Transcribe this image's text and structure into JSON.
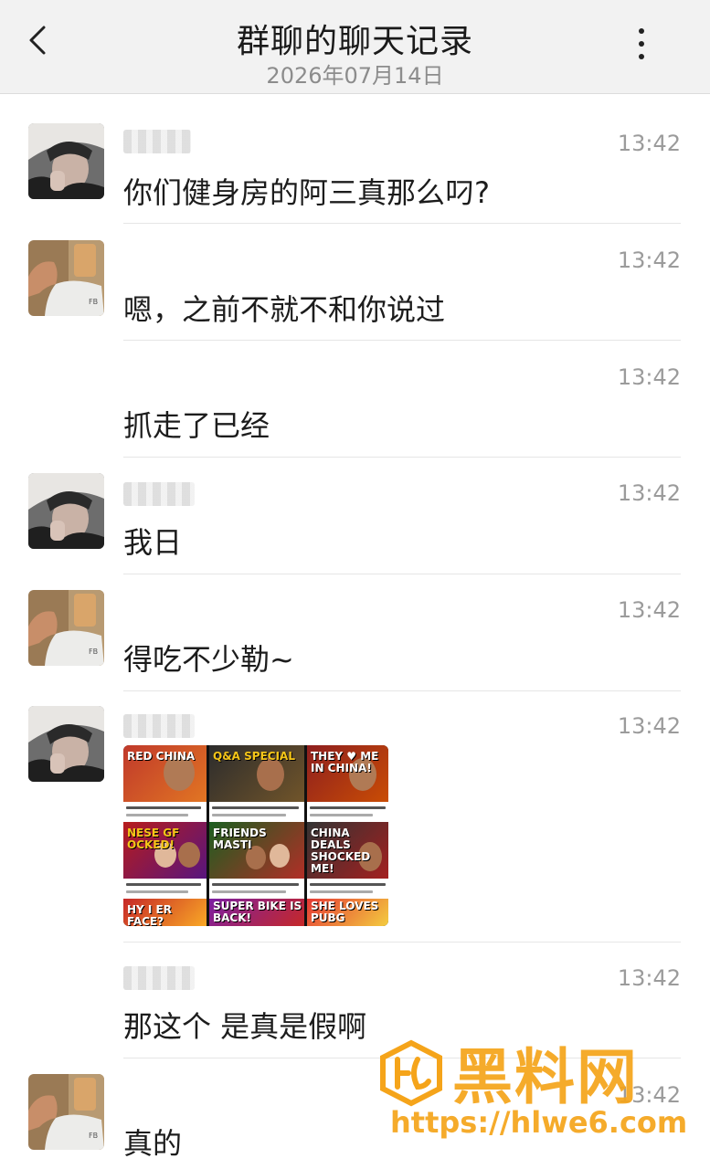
{
  "header": {
    "title": "群聊的聊天记录",
    "subtitle": "2026年07月14日",
    "back_icon": "chevron-left-icon",
    "more_icon": "more-vertical-icon"
  },
  "messages": [
    {
      "avatar": "avatar-cap-boy",
      "time": "13:42",
      "text": "你们健身房的阿三真那么叼?"
    },
    {
      "avatar": "avatar-muscle",
      "time": "13:42",
      "text": "嗯，之前不就不和你说过"
    },
    {
      "avatar": "",
      "time": "13:42",
      "text": "抓走了已经"
    },
    {
      "avatar": "avatar-cap-boy",
      "time": "13:42",
      "text": "我日"
    },
    {
      "avatar": "avatar-muscle",
      "time": "13:42",
      "text": "得吃不少勒~"
    },
    {
      "avatar": "avatar-cap-boy",
      "time": "13:42",
      "image": "video-thumbnails-grid"
    },
    {
      "avatar": "",
      "time": "13:42",
      "text": "那这个 是真是假啊"
    },
    {
      "avatar": "avatar-muscle",
      "time": "13:42",
      "text": "真的"
    }
  ],
  "thumbnails": [
    {
      "banner": "RED CHINA"
    },
    {
      "banner": "Q&A SPECIAL"
    },
    {
      "banner": "THEY ♥ ME IN CHINA!"
    },
    {
      "banner": "NESE GF OCKED!"
    },
    {
      "banner": "FRIENDS MASTI"
    },
    {
      "banner": "CHINA DEALS SHOCKED ME!"
    },
    {
      "banner": "HY I ER FACE?"
    },
    {
      "banner": "SUPER BIKE IS BACK!"
    },
    {
      "banner": "SHE LOVES PUBG"
    }
  ],
  "watermark": {
    "title": "黑料网",
    "url": "https://hlwe6.com",
    "color": "#f5a41a"
  },
  "colors": {
    "header_bg": "#f2f2f2",
    "text": "#1c1c1c",
    "time": "#9b9b9b"
  }
}
